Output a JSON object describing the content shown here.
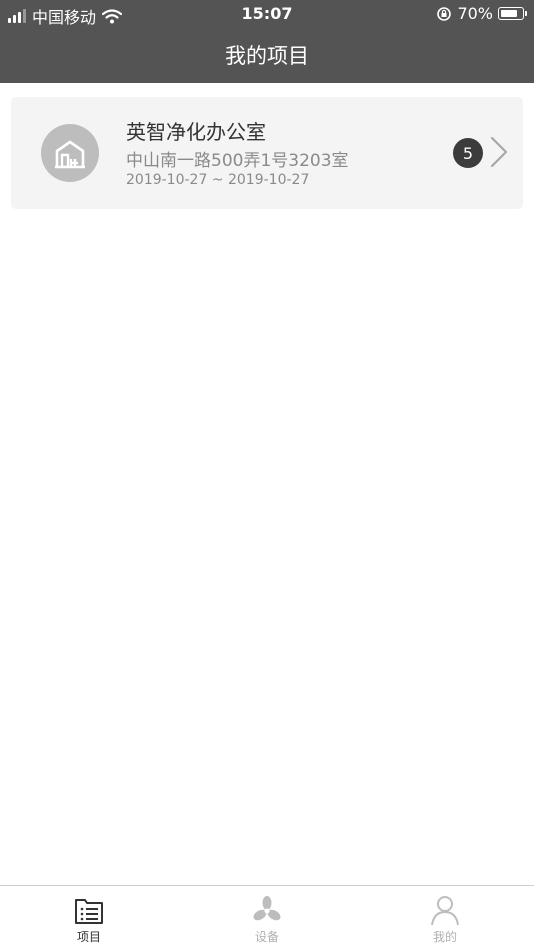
{
  "status_bar": {
    "carrier": "中国移动",
    "time": "15:07",
    "battery": "70%",
    "battery_level": 0.7
  },
  "header": {
    "title": "我的项目"
  },
  "projects": [
    {
      "name": "英智净化办公室",
      "address": "中山南一路500弄1号3203室",
      "date_range": "2019-10-27 ~ 2019-10-27",
      "badge": "5"
    }
  ],
  "tabs": [
    {
      "label": "项目",
      "icon": "project-list-icon",
      "active": true
    },
    {
      "label": "设备",
      "icon": "fan-icon",
      "active": false
    },
    {
      "label": "我的",
      "icon": "user-icon",
      "active": false
    }
  ],
  "colors": {
    "header_bg": "#545454",
    "card_bg": "#f4f4f4",
    "badge_bg": "#3c3c3c",
    "tab_active": "#333333",
    "tab_inactive": "#b0b0b0"
  }
}
